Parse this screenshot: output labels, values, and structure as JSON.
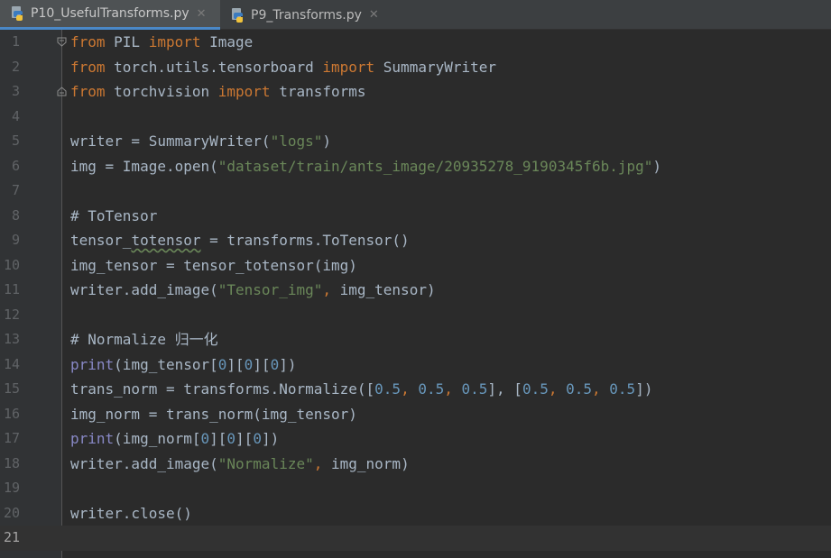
{
  "tabs": [
    {
      "label": "P10_UsefulTransforms.py",
      "active": true,
      "icon": "python-file-icon",
      "close": "✕"
    },
    {
      "label": "P9_Transforms.py",
      "active": false,
      "icon": "python-file-icon",
      "close": "✕"
    }
  ],
  "editor": {
    "language": "python",
    "current_line": 21,
    "lines": [
      {
        "n": "1"
      },
      {
        "n": "2"
      },
      {
        "n": "3"
      },
      {
        "n": "4"
      },
      {
        "n": "5"
      },
      {
        "n": "6"
      },
      {
        "n": "7"
      },
      {
        "n": "8"
      },
      {
        "n": "9"
      },
      {
        "n": "10"
      },
      {
        "n": "11"
      },
      {
        "n": "12"
      },
      {
        "n": "13"
      },
      {
        "n": "14"
      },
      {
        "n": "15"
      },
      {
        "n": "16"
      },
      {
        "n": "17"
      },
      {
        "n": "18"
      },
      {
        "n": "19"
      },
      {
        "n": "20"
      },
      {
        "n": "21"
      }
    ],
    "code": {
      "l1": {
        "a": "from",
        "b": " PIL ",
        "c": "import",
        "d": " Image"
      },
      "l2": {
        "a": "from",
        "b": " torch.utils.tensorboard ",
        "c": "import",
        "d": " SummaryWriter"
      },
      "l3": {
        "a": "from",
        "b": " torchvision ",
        "c": "import",
        "d": " transforms"
      },
      "l5": {
        "a": "writer = SummaryWriter(",
        "b": "\"logs\"",
        "c": ")"
      },
      "l6": {
        "a": "img = Image.open(",
        "b": "\"dataset/train/ants_image/20935278_9190345f6b.jpg\"",
        "c": ")"
      },
      "l8": {
        "a": "# ToTensor"
      },
      "l9": {
        "a": "tensor_",
        "b": "totensor",
        "c": " = transforms.ToTensor()"
      },
      "l10": {
        "a": "img_tensor = tensor_totensor(img)"
      },
      "l11": {
        "a": "writer.add_image(",
        "b": "\"Tensor_img\"",
        "c": ", ",
        "d": "img_tensor)"
      },
      "l13": {
        "a": "# Normalize 归一化"
      },
      "l14": {
        "a": "print",
        "b": "(img_tensor[",
        "c": "0",
        "d": "][",
        "e": "0",
        "f": "][",
        "g": "0",
        "h": "])"
      },
      "l15": {
        "a": "trans_norm = transforms.Normalize([",
        "b": "0.5",
        "c": ", ",
        "d": "0.5",
        "e": ", ",
        "f": "0.5",
        "g": "], [",
        "h": "0.5",
        "i": ", ",
        "j": "0.5",
        "k": ", ",
        "l": "0.5",
        "m": "])"
      },
      "l16": {
        "a": "img_norm = trans_norm(img_tensor)"
      },
      "l17": {
        "a": "print",
        "b": "(img_norm[",
        "c": "0",
        "d": "][",
        "e": "0",
        "f": "][",
        "g": "0",
        "h": "])"
      },
      "l18": {
        "a": "writer.add_image(",
        "b": "\"Normalize\"",
        "c": ", ",
        "d": "img_norm)"
      },
      "l20": {
        "a": "writer.close()"
      }
    }
  },
  "colors": {
    "background": "#2b2b2b",
    "gutter": "#313335",
    "keyword": "#cc7832",
    "string": "#6a8759",
    "comment": "#808080",
    "number": "#6897bb",
    "builtin": "#8888c6",
    "identifier": "#a9b7c6",
    "active_tab_underline": "#4a88c7"
  }
}
